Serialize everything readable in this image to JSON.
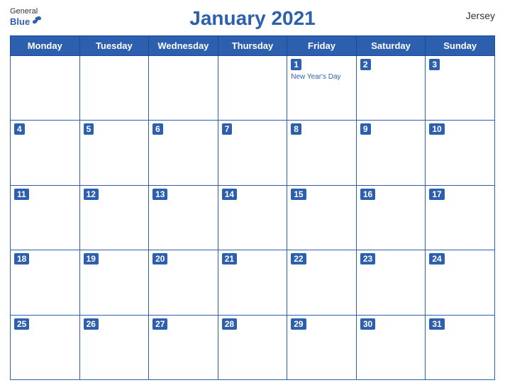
{
  "header": {
    "title": "January 2021",
    "region": "Jersey",
    "logo": {
      "general": "General",
      "blue": "Blue"
    }
  },
  "weekdays": [
    "Monday",
    "Tuesday",
    "Wednesday",
    "Thursday",
    "Friday",
    "Saturday",
    "Sunday"
  ],
  "weeks": [
    [
      {
        "day": null
      },
      {
        "day": null
      },
      {
        "day": null
      },
      {
        "day": null
      },
      {
        "day": 1,
        "holiday": "New Year's Day"
      },
      {
        "day": 2
      },
      {
        "day": 3
      }
    ],
    [
      {
        "day": 4
      },
      {
        "day": 5
      },
      {
        "day": 6
      },
      {
        "day": 7
      },
      {
        "day": 8
      },
      {
        "day": 9
      },
      {
        "day": 10
      }
    ],
    [
      {
        "day": 11
      },
      {
        "day": 12
      },
      {
        "day": 13
      },
      {
        "day": 14
      },
      {
        "day": 15
      },
      {
        "day": 16
      },
      {
        "day": 17
      }
    ],
    [
      {
        "day": 18
      },
      {
        "day": 19
      },
      {
        "day": 20
      },
      {
        "day": 21
      },
      {
        "day": 22
      },
      {
        "day": 23
      },
      {
        "day": 24
      }
    ],
    [
      {
        "day": 25
      },
      {
        "day": 26
      },
      {
        "day": 27
      },
      {
        "day": 28
      },
      {
        "day": 29
      },
      {
        "day": 30
      },
      {
        "day": 31
      }
    ]
  ]
}
